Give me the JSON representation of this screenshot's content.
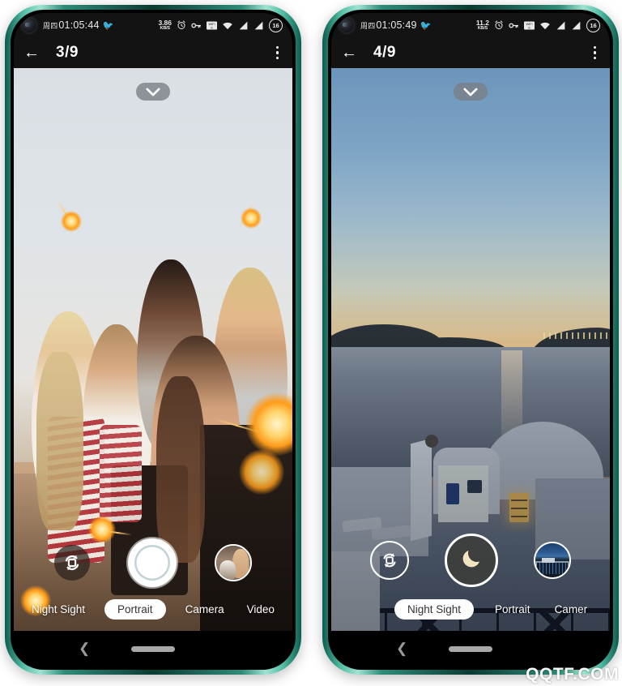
{
  "page": {
    "watermark": "QQTF.COM",
    "background": "#ffffff",
    "frame_color": "#2f8c78"
  },
  "phones": [
    {
      "id": "left",
      "status_bar": {
        "weekday": "周四",
        "time": "01:05:44",
        "net_speed_value": "3.86",
        "net_speed_unit": "KB/S",
        "alarm_icon": "alarm-clock-icon",
        "key_icon": "vpn-key-icon",
        "wifi_badge_icon": "wifi6-icon",
        "wifi_icon": "wifi-signal-icon",
        "signal1_icon": "cell-signal-icon",
        "signal2_icon": "cell-signal-icon",
        "battery_level": "16",
        "notification_icon": "bird-icon",
        "camera_icon": "front-camera-punch-hole"
      },
      "app_bar": {
        "back_icon": "back-arrow-icon",
        "counter": "3/9",
        "overflow_icon": "more-vert-icon"
      },
      "viewfinder": {
        "scene": "group-selfie-with-sparklers",
        "collapse_icon": "chevron-down-icon"
      },
      "controls": {
        "flip_icon": "camera-flip-icon",
        "shutter_label": "shutter-button-portrait",
        "thumbnail_label": "gallery-thumbnail-woman-with-dog"
      },
      "modes": [
        {
          "label": "Night Sight",
          "active": false
        },
        {
          "label": "Portrait",
          "active": true
        },
        {
          "label": "Camera",
          "active": false
        },
        {
          "label": "Video",
          "active": false
        }
      ],
      "nav_bar": {
        "back_icon": "nav-back-icon",
        "home_pill": "home-gesture-pill"
      }
    },
    {
      "id": "right",
      "status_bar": {
        "weekday": "周四",
        "time": "01:05:49",
        "net_speed_value": "11.2",
        "net_speed_unit": "KB/S",
        "alarm_icon": "alarm-clock-icon",
        "key_icon": "vpn-key-icon",
        "wifi_badge_icon": "wifi6-icon",
        "wifi_icon": "wifi-signal-icon",
        "signal1_icon": "cell-signal-icon",
        "signal2_icon": "cell-signal-icon",
        "battery_level": "16",
        "notification_icon": "bird-icon",
        "camera_icon": "front-camera-punch-hole"
      },
      "app_bar": {
        "back_icon": "back-arrow-icon",
        "counter": "4/9",
        "overflow_icon": "more-vert-icon"
      },
      "viewfinder": {
        "scene": "santorini-sunset-seascape",
        "collapse_icon": "chevron-down-icon"
      },
      "controls": {
        "flip_icon": "camera-flip-icon",
        "shutter_label": "shutter-button-night-sight",
        "thumbnail_label": "gallery-thumbnail-cityscape"
      },
      "modes": [
        {
          "label": "Night Sight",
          "active": true
        },
        {
          "label": "Portrait",
          "active": false
        },
        {
          "label": "Camer",
          "active": false
        }
      ],
      "nav_bar": {
        "back_icon": "nav-back-icon",
        "home_pill": "home-gesture-pill"
      }
    }
  ]
}
